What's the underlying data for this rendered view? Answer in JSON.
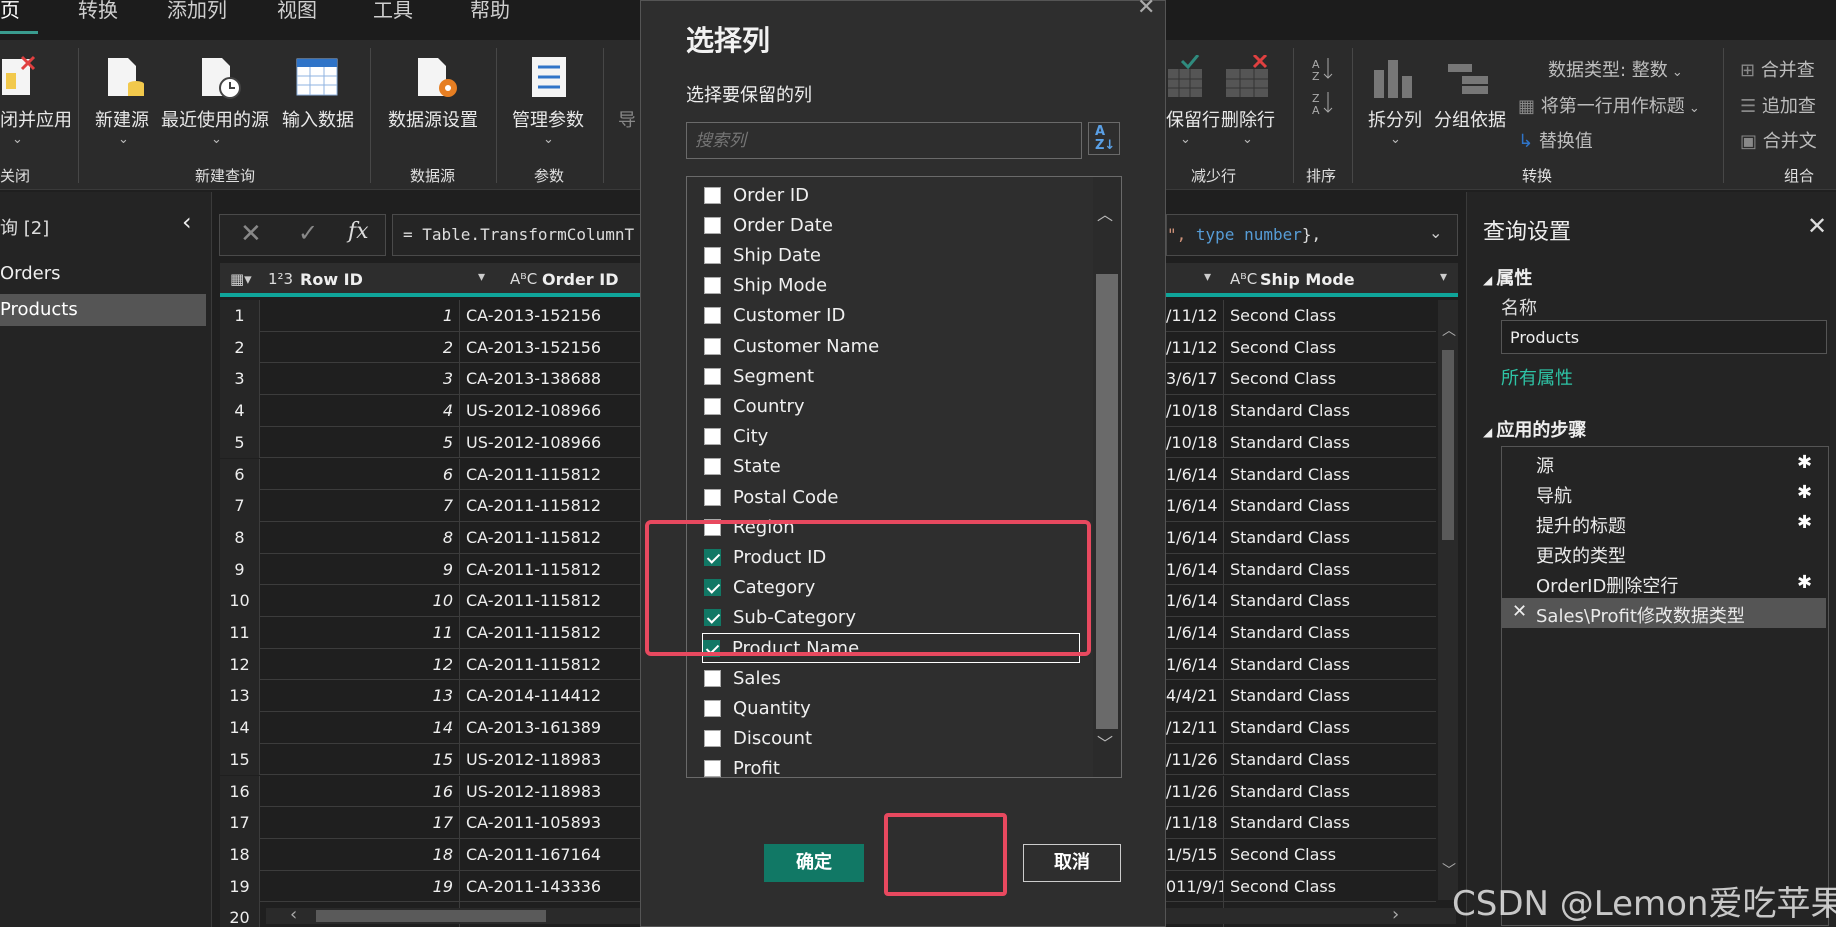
{
  "menu": {
    "home_partial": "页",
    "transform": "转换",
    "add_column": "添加列",
    "view": "视图",
    "tools": "工具",
    "help": "帮助"
  },
  "ribbon": {
    "close_apply": "闭并应用",
    "close_group": "关闭",
    "new_source": "新建源",
    "recent_sources": "最近使用的源",
    "enter_data": "输入数据",
    "new_query_group": "新建查询",
    "data_source_settings": "数据源设置",
    "data_source_group": "数据源",
    "manage_params": "管理参数",
    "params_group": "参数",
    "partial_import": "导",
    "keep_rows": "保留行",
    "remove_rows": "删除行",
    "reduce_rows_group": "减少行",
    "sort_group": "排序",
    "split_column": "拆分列",
    "group_by": "分组依据",
    "data_type": "数据类型: 整数",
    "first_row_header": "将第一行用作标题",
    "replace_values": "替换值",
    "transform_group": "转换",
    "merge": "合并查",
    "append": "追加查",
    "combine_files": "合并文",
    "combine_group": "组合"
  },
  "left": {
    "queries_label": "询 [2]",
    "items": [
      "Orders",
      "Products"
    ]
  },
  "formula": {
    "left_text": "= Table.TransformColumnT",
    "right_text_1": "\", ",
    "right_kw_1": "type",
    "right_kw_2": "number",
    "right_text_2": "},"
  },
  "grid": {
    "col1": "Row ID",
    "col1_type": "1²3",
    "col2": "Order ID",
    "col2_type": "AᴮC",
    "col_last": "Ship Mode",
    "col_last_type": "AᴮC",
    "rows": [
      [
        "1",
        "1",
        "CA-2013-152156",
        "/11/12",
        "Second Class"
      ],
      [
        "2",
        "2",
        "CA-2013-152156",
        "/11/12",
        "Second Class"
      ],
      [
        "3",
        "3",
        "CA-2013-138688",
        "3/6/17",
        "Second Class"
      ],
      [
        "4",
        "4",
        "US-2012-108966",
        "/10/18",
        "Standard Class"
      ],
      [
        "5",
        "5",
        "US-2012-108966",
        "/10/18",
        "Standard Class"
      ],
      [
        "6",
        "6",
        "CA-2011-115812",
        "1/6/14",
        "Standard Class"
      ],
      [
        "7",
        "7",
        "CA-2011-115812",
        "1/6/14",
        "Standard Class"
      ],
      [
        "8",
        "8",
        "CA-2011-115812",
        "1/6/14",
        "Standard Class"
      ],
      [
        "9",
        "9",
        "CA-2011-115812",
        "1/6/14",
        "Standard Class"
      ],
      [
        "10",
        "10",
        "CA-2011-115812",
        "1/6/14",
        "Standard Class"
      ],
      [
        "11",
        "11",
        "CA-2011-115812",
        "1/6/14",
        "Standard Class"
      ],
      [
        "12",
        "12",
        "CA-2011-115812",
        "1/6/14",
        "Standard Class"
      ],
      [
        "13",
        "13",
        "CA-2014-114412",
        "4/4/21",
        "Standard Class"
      ],
      [
        "14",
        "14",
        "CA-2013-161389",
        "/12/11",
        "Standard Class"
      ],
      [
        "15",
        "15",
        "US-2012-118983",
        "/11/26",
        "Standard Class"
      ],
      [
        "16",
        "16",
        "US-2012-118983",
        "/11/26",
        "Standard Class"
      ],
      [
        "17",
        "17",
        "CA-2011-105893",
        "/11/18",
        "Standard Class"
      ],
      [
        "18",
        "18",
        "CA-2011-167164",
        "1/5/15",
        "Second Class"
      ],
      [
        "19",
        "19",
        "CA-2011-143336",
        "011/9/1",
        "Second Class"
      ],
      [
        "20",
        "",
        "",
        "",
        ""
      ]
    ]
  },
  "dialog": {
    "title": "选择列",
    "subtitle": "选择要保留的列",
    "search_placeholder": "搜索列",
    "columns": [
      {
        "name": "Order ID",
        "checked": false
      },
      {
        "name": "Order Date",
        "checked": false
      },
      {
        "name": "Ship Date",
        "checked": false
      },
      {
        "name": "Ship Mode",
        "checked": false
      },
      {
        "name": "Customer ID",
        "checked": false
      },
      {
        "name": "Customer Name",
        "checked": false
      },
      {
        "name": "Segment",
        "checked": false
      },
      {
        "name": "Country",
        "checked": false
      },
      {
        "name": "City",
        "checked": false
      },
      {
        "name": "State",
        "checked": false
      },
      {
        "name": "Postal Code",
        "checked": false
      },
      {
        "name": "Region",
        "checked": false
      },
      {
        "name": "Product ID",
        "checked": true
      },
      {
        "name": "Category",
        "checked": true
      },
      {
        "name": "Sub-Category",
        "checked": true
      },
      {
        "name": "Product Name",
        "checked": true
      },
      {
        "name": "Sales",
        "checked": false
      },
      {
        "name": "Quantity",
        "checked": false
      },
      {
        "name": "Discount",
        "checked": false
      },
      {
        "name": "Profit",
        "checked": false
      }
    ],
    "ok": "确定",
    "cancel": "取消"
  },
  "settings": {
    "title": "查询设置",
    "properties": "属性",
    "name_label": "名称",
    "name_value": "Products",
    "all_props": "所有属性",
    "applied_steps": "应用的步骤",
    "steps": [
      {
        "label": "源",
        "gear": true
      },
      {
        "label": "导航",
        "gear": true
      },
      {
        "label": "提升的标题",
        "gear": true
      },
      {
        "label": "更改的类型",
        "gear": false
      },
      {
        "label": "OrderID删除空行",
        "gear": true
      },
      {
        "label": "Sales\\Profit修改数据类型",
        "gear": false
      }
    ]
  },
  "watermark": "CSDN @Lemon爱吃苹果",
  "colors": {
    "accent": "#117865",
    "highlight": "#e8495f",
    "teal_bar": "#0fa59a"
  }
}
